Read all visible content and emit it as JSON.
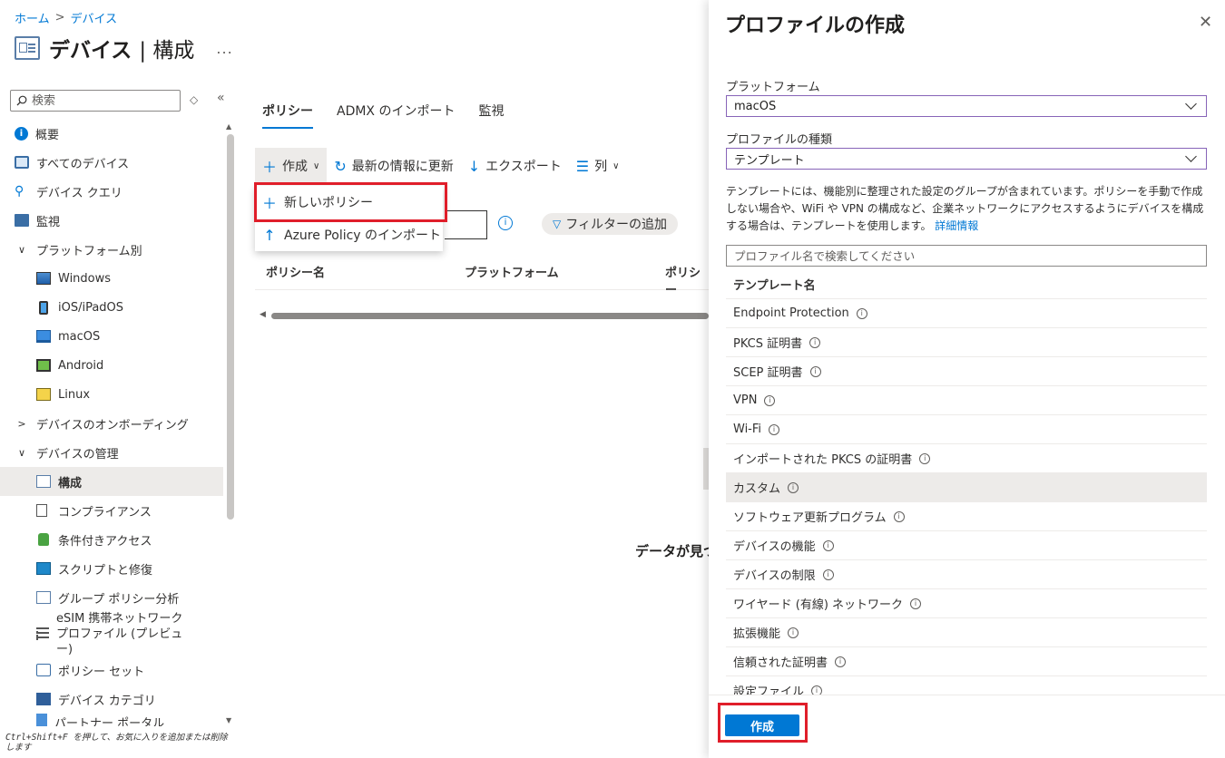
{
  "breadcrumb": {
    "home": "ホーム",
    "devices": "デバイス"
  },
  "page": {
    "title": "デバイス",
    "subtitle": "構成",
    "more": "..."
  },
  "sidebar": {
    "search_placeholder": "検索",
    "items": [
      {
        "label": "概要",
        "icon": "info-icon"
      },
      {
        "label": "すべてのデバイス",
        "icon": "devices-icon"
      },
      {
        "label": "デバイス クエリ",
        "icon": "query-icon"
      },
      {
        "label": "監視",
        "icon": "monitor-icon"
      },
      {
        "label": "プラットフォーム別",
        "icon": "chevron-down-icon"
      },
      {
        "label": "Windows",
        "icon": "windows-icon"
      },
      {
        "label": "iOS/iPadOS",
        "icon": "ios-icon"
      },
      {
        "label": "macOS",
        "icon": "macos-icon"
      },
      {
        "label": "Android",
        "icon": "android-icon"
      },
      {
        "label": "Linux",
        "icon": "linux-icon"
      },
      {
        "label": "デバイスのオンボーディング",
        "icon": "chevron-right-icon"
      },
      {
        "label": "デバイスの管理",
        "icon": "chevron-down-icon"
      },
      {
        "label": "構成",
        "icon": "configuration-icon"
      },
      {
        "label": "コンプライアンス",
        "icon": "compliance-icon"
      },
      {
        "label": "条件付きアクセス",
        "icon": "lock-icon"
      },
      {
        "label": "スクリプトと修復",
        "icon": "script-icon"
      },
      {
        "label": "グループ ポリシー分析",
        "icon": "group-policy-icon"
      },
      {
        "label": "eSIM 携帯ネットワーク プロファイル (プレビュー)",
        "icon": "esim-icon"
      },
      {
        "label": "ポリシー セット",
        "icon": "policy-set-icon"
      },
      {
        "label": "デバイス カテゴリ",
        "icon": "category-icon"
      },
      {
        "label": "パートナー ポータル",
        "icon": "portal-icon"
      }
    ],
    "hint": "Ctrl+Shift+F を押して、お気に入りを追加または削除します"
  },
  "main": {
    "tabs": [
      {
        "label": "ポリシー"
      },
      {
        "label": "ADMX のインポート"
      },
      {
        "label": "監視"
      }
    ],
    "toolbar": {
      "create": "作成",
      "refresh": "最新の情報に更新",
      "export": "エクスポート",
      "columns": "列"
    },
    "dropdown": {
      "new_policy": "新しいポリシー",
      "azure_import": "Azure Policy のインポート"
    },
    "filter_label": "フィルターの追加",
    "columns": [
      "ポリシー名",
      "プラットフォーム",
      "ポリシー"
    ],
    "no_data": "データが見つかりません"
  },
  "panel": {
    "title": "プロファイルの作成",
    "platform_label": "プラットフォーム",
    "platform_value": "macOS",
    "profile_type_label": "プロファイルの種類",
    "profile_type_value": "テンプレート",
    "description": "テンプレートには、機能別に整理された設定のグループが含まれています。ポリシーを手動で作成しない場合や、WiFi や VPN の構成など、企業ネットワークにアクセスするようにデバイスを構成する場合は、テンプレートを使用します。",
    "learn_more": "詳細情報",
    "search_placeholder": "プロファイル名で検索してください",
    "template_header": "テンプレート名",
    "templates": [
      "Endpoint Protection",
      "PKCS 証明書",
      "SCEP 証明書",
      "VPN",
      "Wi-Fi",
      "インポートされた PKCS の証明書",
      "カスタム",
      "ソフトウェア更新プログラム",
      "デバイスの機能",
      "デバイスの制限",
      "ワイヤード (有線) ネットワーク",
      "拡張機能",
      "信頼された証明書",
      "設定ファイル"
    ],
    "selected_template": "カスタム",
    "create_button": "作成"
  },
  "colors": {
    "accent": "#0078d4",
    "highlight": "#e01e2a",
    "select_border": "#8764b8"
  }
}
